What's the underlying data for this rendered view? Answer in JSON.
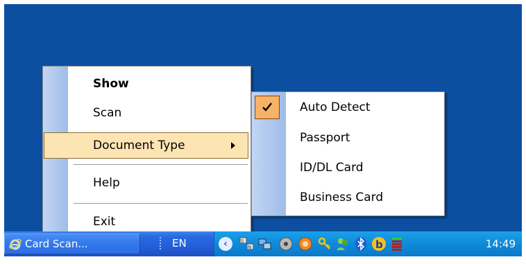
{
  "taskbar": {
    "task_button_label": "Card Scan...",
    "language": "EN",
    "clock": "14:49",
    "tray_expand_glyph": "‹",
    "tray_icons": [
      "sound-icon",
      "network-icon",
      "disk-icon",
      "media-icon",
      "key-icon",
      "people-icon",
      "bluetooth-icon",
      "b-app-icon",
      "bars-icon"
    ]
  },
  "main_menu": {
    "items": [
      {
        "label": "Show",
        "bold": true
      },
      {
        "label": "Scan"
      },
      {
        "label": "Document Type",
        "has_submenu": true,
        "highlighted": true
      },
      {
        "label": "Help"
      },
      {
        "label": "Exit"
      }
    ]
  },
  "sub_menu": {
    "items": [
      {
        "label": "Auto Detect",
        "checked": true
      },
      {
        "label": "Passport"
      },
      {
        "label": "ID/DL Card"
      },
      {
        "label": "Business Card"
      }
    ]
  },
  "colors": {
    "desktop": "#0c4fa1",
    "highlight": "#fde4b3",
    "check": "#f6b267",
    "menu_strip": "#9fbce8"
  }
}
